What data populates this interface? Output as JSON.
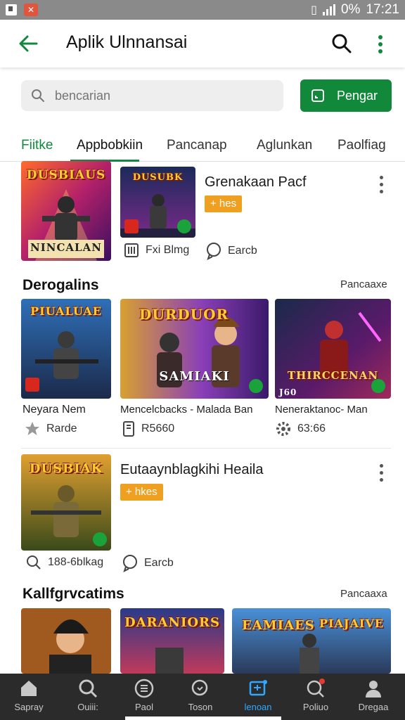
{
  "status": {
    "time": "17:21",
    "battery": "0%"
  },
  "appbar": {
    "title": "Aplik Ulnnansai"
  },
  "search": {
    "placeholder": "bencarian",
    "button_label": "Pengar"
  },
  "tabs": [
    "Fiitke",
    "Appbobkiin",
    "Pancanap",
    "Aglunkan",
    "Paolfiag"
  ],
  "featured_top": {
    "art1_title": "DUSBIAUS",
    "art1_sub": "NINCALAN",
    "art2_title": "DUSUBK",
    "title": "Grenakaan Pacf",
    "badge": "+ hes",
    "meta1": "Fxi Blmg",
    "meta2": "Earcb"
  },
  "section1": {
    "title": "Derogalins",
    "more": "Pancaaxe",
    "items": [
      {
        "art_title": "PIUALUAE",
        "caption": "Neyara Nem",
        "meta": "Rarde",
        "meta_icon": "star-icon"
      },
      {
        "art_title": "DURDUOR",
        "art_sub": "SAMIAKI",
        "caption": "Mencelcbacks - Malada Ban",
        "meta": "R5660",
        "meta_icon": "phone-icon"
      },
      {
        "art_title": "THIRCCENAN",
        "art_tag": "J60",
        "caption": "Neneraktanoc- Man",
        "meta": "63:66",
        "meta_icon": "gear-icon"
      }
    ]
  },
  "featured_mid": {
    "art_title": "DUSBIAK",
    "title": "Eutaaynblagkihi Heaila",
    "badge": "+ hkes",
    "meta1": "188-6blkag",
    "meta2": "Earcb"
  },
  "section2": {
    "title": "Kallfgrvcatims",
    "more": "Pancaaxa",
    "items": [
      {
        "art_title": ""
      },
      {
        "art_title": "DARANIORS"
      },
      {
        "art_title": "EAMIAES",
        "art_title2": "PIAJAIVE"
      }
    ]
  },
  "bottomnav": [
    {
      "label": "Sapray",
      "icon": "home-icon"
    },
    {
      "label": "Ouiii:",
      "icon": "search-icon"
    },
    {
      "label": "Paol",
      "icon": "list-icon"
    },
    {
      "label": "Toson",
      "icon": "magnifier-icon"
    },
    {
      "label": "lenoan",
      "icon": "apps-icon",
      "active": true
    },
    {
      "label": "Poliuo",
      "icon": "notification-icon"
    },
    {
      "label": "Dregaa",
      "icon": "person-icon"
    }
  ],
  "colors": {
    "accent": "#12883b",
    "badge": "#f0a020",
    "nav_active": "#2fa8ff"
  }
}
